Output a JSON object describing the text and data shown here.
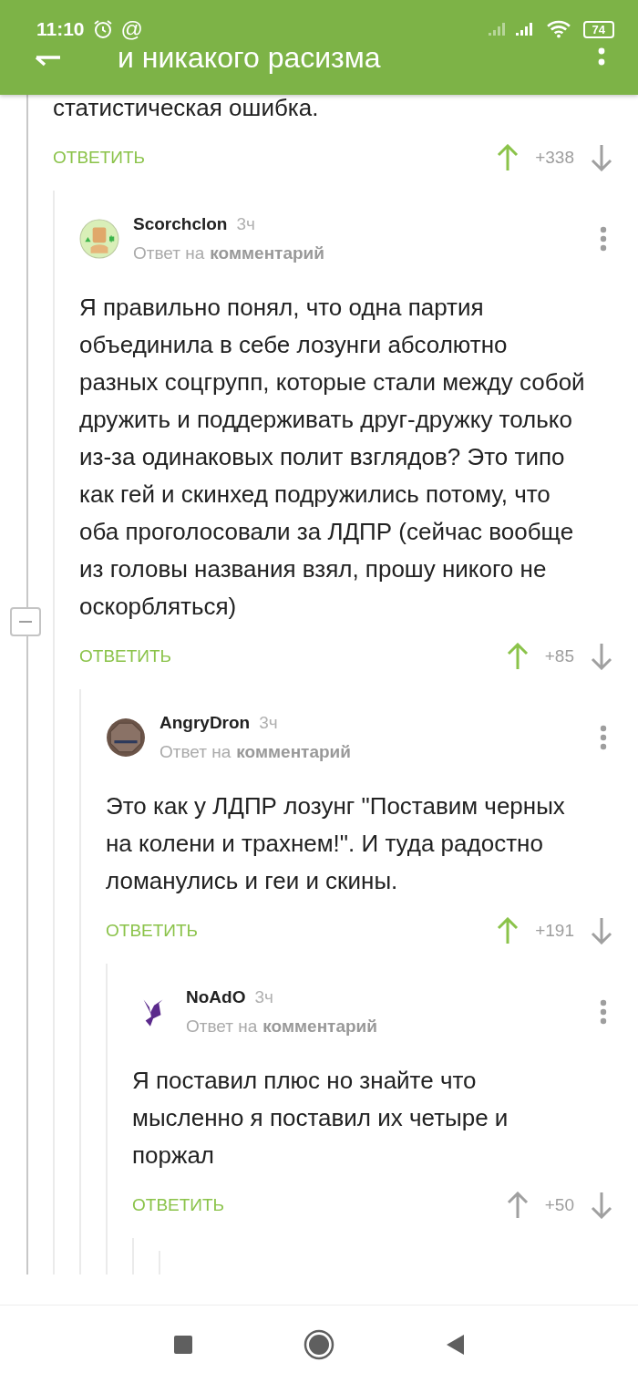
{
  "status_bar": {
    "time": "11:10",
    "mention_icon": "@",
    "battery": "74"
  },
  "toolbar": {
    "title": "и никакого расизма"
  },
  "parent_comment": {
    "text": "статистическая ошибка.",
    "reply_label": "ОТВЕТИТЬ",
    "rating": "+338",
    "upvoted": true
  },
  "comments": [
    {
      "author": "Scorchclon",
      "age": "3ч",
      "reply_prefix": "Ответ на",
      "reply_link": "комментарий",
      "avatar": {
        "kind": "figure"
      },
      "text": "Я правильно понял, что одна партия объединила в себе лозунги абсолютно разных соцгрупп, которые стали между собой дружить и поддерживать друг-дружку только из-за одинаковых полит взглядов? Это типо как гей и скинхед подружились потому, что оба проголосовали за ЛДПР (сейчас вообще из головы названия взял, прошу никого не оскорбляться)",
      "reply_label": "ОТВЕТИТЬ",
      "rating": "+85",
      "upvoted": true,
      "collapsible": true,
      "children": [
        {
          "author": "AngryDron",
          "age": "3ч",
          "reply_prefix": "Ответ на",
          "reply_link": "комментарий",
          "avatar": {
            "kind": "sign"
          },
          "text": "Это как у ЛДПР лозунг \"Поставим черных на колени и трахнем!\". И туда радостно ломанулись и геи и скины.",
          "reply_label": "ОТВЕТИТЬ",
          "rating": "+191",
          "upvoted": true,
          "collapsible": false,
          "children": [
            {
              "author": "NoAdO",
              "age": "3ч",
              "reply_prefix": "Ответ на",
              "reply_link": "комментарий",
              "avatar": {
                "kind": "emblem"
              },
              "text": "Я поставил плюс но знайте что мысленно я поставил их четыре и поржал",
              "reply_label": "ОТВЕТИТЬ",
              "rating": "+50",
              "upvoted": false,
              "collapsible": false
            }
          ]
        }
      ]
    }
  ]
}
